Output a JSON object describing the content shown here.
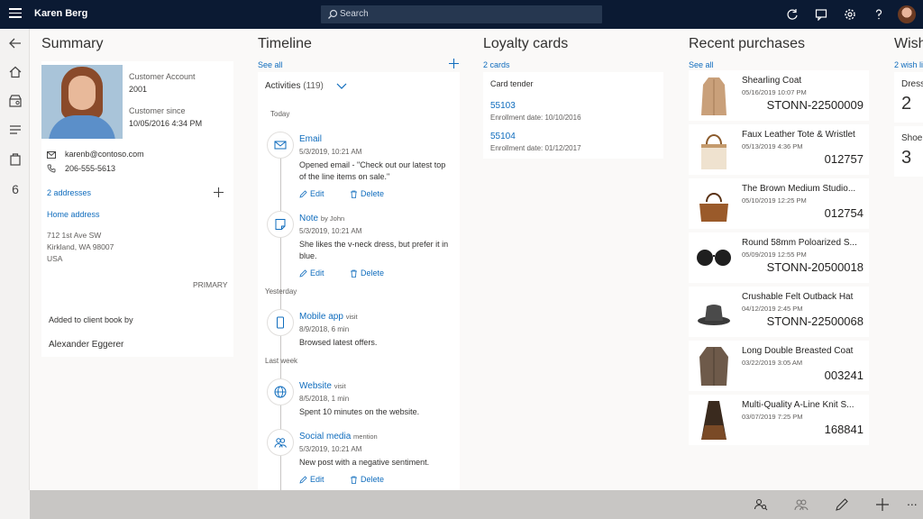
{
  "app": {
    "title": "Karen Berg",
    "search_placeholder": "Search"
  },
  "leftnav": {
    "count": "6"
  },
  "summary": {
    "title": "Summary",
    "account_label": "Customer Account",
    "account_value": "2001",
    "since_label": "Customer since",
    "since_value": "10/05/2016 4:34 PM",
    "email": "karenb@contoso.com",
    "phone": "206-555-5613",
    "addresses_link": "2 addresses",
    "home_link": "Home address",
    "address_line1": "712 1st Ave SW",
    "address_line2": "Kirkland, WA 98007",
    "address_line3": "USA",
    "primary": "PRIMARY",
    "client_book_label": "Added to client book by",
    "client_book_name": "Alexander Eggerer"
  },
  "timeline": {
    "title": "Timeline",
    "see_all": "See all",
    "activities": "Activities",
    "activities_count": "(119)",
    "groups": {
      "today": "Today",
      "yesterday": "Yesterday",
      "last_week": "Last week"
    },
    "edit": "Edit",
    "delete": "Delete",
    "items": [
      {
        "title": "Email",
        "sub": "",
        "date": "5/3/2019, 10:21 AM",
        "body1": "Opened email - \"Check out our latest top",
        "body2": "of the line items on sale.\""
      },
      {
        "title": "Note",
        "sub": "by John",
        "date": "5/3/2019, 10:21 AM",
        "body1": "She likes the v-neck dress, but prefer it in",
        "body2": "blue."
      },
      {
        "title": "Mobile app",
        "sub": "visit",
        "date": "8/9/2018, 6 min",
        "body1": "Browsed latest offers.",
        "body2": ""
      },
      {
        "title": "Website",
        "sub": "visit",
        "date": "8/5/2018, 1 min",
        "body1": "Spent 10 minutes on the website.",
        "body2": ""
      },
      {
        "title": "Social media",
        "sub": "mention",
        "date": "5/3/2019, 10:21 AM",
        "body1": "New post with a negative sentiment.",
        "body2": ""
      }
    ]
  },
  "loyalty": {
    "title": "Loyalty cards",
    "count_link": "2 cards",
    "tender": "Card tender",
    "cards": [
      {
        "number": "55103",
        "date": "Enrollment date: 10/10/2016"
      },
      {
        "number": "55104",
        "date": "Enrollment date: 01/12/2017"
      }
    ]
  },
  "purchases": {
    "title": "Recent purchases",
    "see_all": "See all",
    "items": [
      {
        "name": "Shearling Coat",
        "date": "05/16/2019 10:07 PM",
        "id": "STONN-22500009"
      },
      {
        "name": "Faux Leather Tote & Wristlet",
        "date": "05/13/2019 4:36 PM",
        "id": "012757"
      },
      {
        "name": "The Brown Medium Studio...",
        "date": "05/10/2019 12:25 PM",
        "id": "012754"
      },
      {
        "name": "Round 58mm Poloarized S...",
        "date": "05/09/2019 12:55 PM",
        "id": "STONN-20500018"
      },
      {
        "name": "Crushable Felt Outback Hat",
        "date": "04/12/2019 2:45 PM",
        "id": "STONN-22500068"
      },
      {
        "name": "Long Double Breasted Coat",
        "date": "03/22/2019 3:05 AM",
        "id": "003241"
      },
      {
        "name": "Multi-Quality A-Line Knit S...",
        "date": "03/07/2019 7:25 PM",
        "id": "168841"
      }
    ]
  },
  "wishlist": {
    "title": "Wish",
    "count_link": "2 wish li",
    "items": [
      {
        "name": "Dress",
        "count": "2"
      },
      {
        "name": "Shoe",
        "count": "3"
      }
    ]
  },
  "bottombar": {
    "more": "..."
  }
}
